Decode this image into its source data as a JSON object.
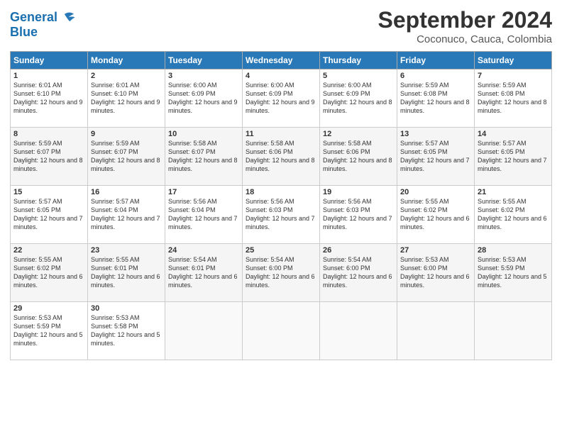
{
  "logo": {
    "line1": "General",
    "line2": "Blue"
  },
  "title": "September 2024",
  "subtitle": "Coconuco, Cauca, Colombia",
  "days_header": [
    "Sunday",
    "Monday",
    "Tuesday",
    "Wednesday",
    "Thursday",
    "Friday",
    "Saturday"
  ],
  "weeks": [
    [
      {
        "day": "1",
        "sunrise": "6:01 AM",
        "sunset": "6:10 PM",
        "daylight": "12 hours and 9 minutes."
      },
      {
        "day": "2",
        "sunrise": "6:01 AM",
        "sunset": "6:10 PM",
        "daylight": "12 hours and 9 minutes."
      },
      {
        "day": "3",
        "sunrise": "6:00 AM",
        "sunset": "6:09 PM",
        "daylight": "12 hours and 9 minutes."
      },
      {
        "day": "4",
        "sunrise": "6:00 AM",
        "sunset": "6:09 PM",
        "daylight": "12 hours and 9 minutes."
      },
      {
        "day": "5",
        "sunrise": "6:00 AM",
        "sunset": "6:09 PM",
        "daylight": "12 hours and 8 minutes."
      },
      {
        "day": "6",
        "sunrise": "5:59 AM",
        "sunset": "6:08 PM",
        "daylight": "12 hours and 8 minutes."
      },
      {
        "day": "7",
        "sunrise": "5:59 AM",
        "sunset": "6:08 PM",
        "daylight": "12 hours and 8 minutes."
      }
    ],
    [
      {
        "day": "8",
        "sunrise": "5:59 AM",
        "sunset": "6:07 PM",
        "daylight": "12 hours and 8 minutes."
      },
      {
        "day": "9",
        "sunrise": "5:59 AM",
        "sunset": "6:07 PM",
        "daylight": "12 hours and 8 minutes."
      },
      {
        "day": "10",
        "sunrise": "5:58 AM",
        "sunset": "6:07 PM",
        "daylight": "12 hours and 8 minutes."
      },
      {
        "day": "11",
        "sunrise": "5:58 AM",
        "sunset": "6:06 PM",
        "daylight": "12 hours and 8 minutes."
      },
      {
        "day": "12",
        "sunrise": "5:58 AM",
        "sunset": "6:06 PM",
        "daylight": "12 hours and 8 minutes."
      },
      {
        "day": "13",
        "sunrise": "5:57 AM",
        "sunset": "6:05 PM",
        "daylight": "12 hours and 7 minutes."
      },
      {
        "day": "14",
        "sunrise": "5:57 AM",
        "sunset": "6:05 PM",
        "daylight": "12 hours and 7 minutes."
      }
    ],
    [
      {
        "day": "15",
        "sunrise": "5:57 AM",
        "sunset": "6:05 PM",
        "daylight": "12 hours and 7 minutes."
      },
      {
        "day": "16",
        "sunrise": "5:57 AM",
        "sunset": "6:04 PM",
        "daylight": "12 hours and 7 minutes."
      },
      {
        "day": "17",
        "sunrise": "5:56 AM",
        "sunset": "6:04 PM",
        "daylight": "12 hours and 7 minutes."
      },
      {
        "day": "18",
        "sunrise": "5:56 AM",
        "sunset": "6:03 PM",
        "daylight": "12 hours and 7 minutes."
      },
      {
        "day": "19",
        "sunrise": "5:56 AM",
        "sunset": "6:03 PM",
        "daylight": "12 hours and 7 minutes."
      },
      {
        "day": "20",
        "sunrise": "5:55 AM",
        "sunset": "6:02 PM",
        "daylight": "12 hours and 6 minutes."
      },
      {
        "day": "21",
        "sunrise": "5:55 AM",
        "sunset": "6:02 PM",
        "daylight": "12 hours and 6 minutes."
      }
    ],
    [
      {
        "day": "22",
        "sunrise": "5:55 AM",
        "sunset": "6:02 PM",
        "daylight": "12 hours and 6 minutes."
      },
      {
        "day": "23",
        "sunrise": "5:55 AM",
        "sunset": "6:01 PM",
        "daylight": "12 hours and 6 minutes."
      },
      {
        "day": "24",
        "sunrise": "5:54 AM",
        "sunset": "6:01 PM",
        "daylight": "12 hours and 6 minutes."
      },
      {
        "day": "25",
        "sunrise": "5:54 AM",
        "sunset": "6:00 PM",
        "daylight": "12 hours and 6 minutes."
      },
      {
        "day": "26",
        "sunrise": "5:54 AM",
        "sunset": "6:00 PM",
        "daylight": "12 hours and 6 minutes."
      },
      {
        "day": "27",
        "sunrise": "5:53 AM",
        "sunset": "6:00 PM",
        "daylight": "12 hours and 6 minutes."
      },
      {
        "day": "28",
        "sunrise": "5:53 AM",
        "sunset": "5:59 PM",
        "daylight": "12 hours and 5 minutes."
      }
    ],
    [
      {
        "day": "29",
        "sunrise": "5:53 AM",
        "sunset": "5:59 PM",
        "daylight": "12 hours and 5 minutes."
      },
      {
        "day": "30",
        "sunrise": "5:53 AM",
        "sunset": "5:58 PM",
        "daylight": "12 hours and 5 minutes."
      },
      null,
      null,
      null,
      null,
      null
    ]
  ]
}
